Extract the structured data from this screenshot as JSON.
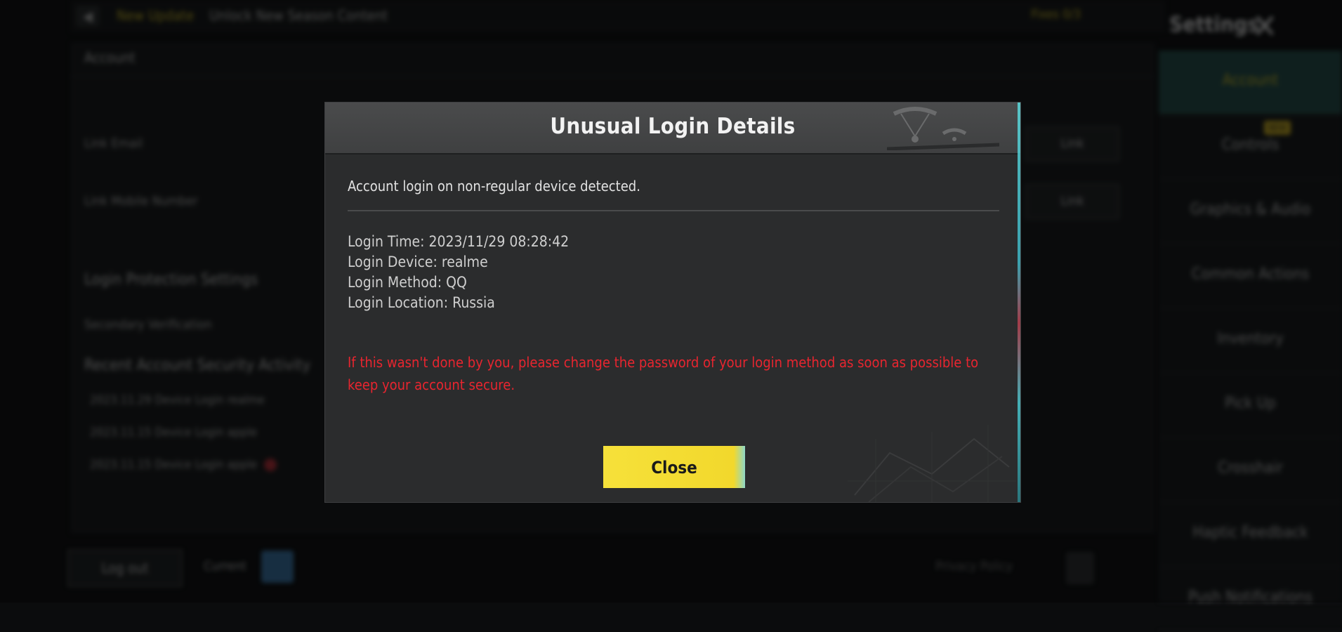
{
  "background": {
    "back_icon": "arrow-left-icon",
    "update_new": "New Update",
    "update_text": "Unlock New Season Content",
    "fixes": "Fixes 0/3",
    "settings_title": "Settings",
    "close_icon": "x-icon",
    "panel_title": "Account",
    "link_rows": [
      {
        "label": "Link Email",
        "button": "Link"
      },
      {
        "label": "Link Mobile Number",
        "button": "Link"
      }
    ],
    "protection_title": "Login Protection Settings",
    "secondary_verification": "Secondary Verification",
    "recent_title": "Recent Account Security Activity",
    "activities": [
      "2023.11.29  Device Login  realme",
      "2023.11.15  Device Login  apple",
      "2023.11.15  Device Login  apple"
    ],
    "logout": "Log out",
    "current": "Current",
    "privacy": "Privacy Policy",
    "sidebar": [
      {
        "label": "Account",
        "active": true
      },
      {
        "label": "Controls",
        "active": false
      },
      {
        "label": "Graphics & Audio",
        "active": false
      },
      {
        "label": "Common Actions",
        "active": false
      },
      {
        "label": "Inventory",
        "active": false
      },
      {
        "label": "Pick Up",
        "active": false
      },
      {
        "label": "Crosshair",
        "active": false
      },
      {
        "label": "Haptic Feedback",
        "active": false
      },
      {
        "label": "Push Notifications",
        "active": false
      }
    ],
    "new_badge": "NEW"
  },
  "dialog": {
    "title": "Unusual Login Details",
    "message": "Account login on non-regular device detected.",
    "details": [
      "Login Time: 2023/11/29 08:28:42",
      "Login Device: realme",
      "Login Method: QQ",
      "Login Location: Russia"
    ],
    "warning": "If this wasn't done by you, please change the password of your login method as soon as possible to keep your account secure.",
    "close_label": "Close",
    "colors": {
      "warning": "#e8252f",
      "button": "#f2d82c",
      "accent_edge": "#5de3e6"
    }
  }
}
